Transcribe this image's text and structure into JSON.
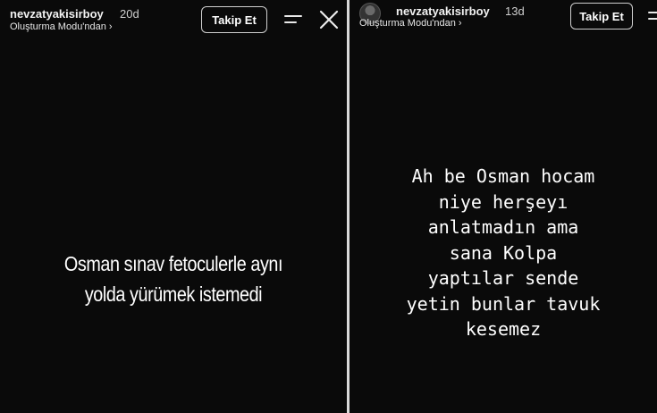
{
  "left_story": {
    "username": "nevzatyakisirboy",
    "time": "20d",
    "subtitle": "Oluşturma Modu'ndan ›",
    "follow_label": "Takip Et",
    "text_lines": [
      "Osman sınav fetoculerle aynı",
      "yolda yürümek istemedi"
    ]
  },
  "right_story": {
    "username": "nevzatyakisirboy",
    "time": "13d",
    "subtitle": "Oluşturma Modu'ndan ›",
    "follow_label": "Takip Et",
    "text_lines": [
      "Ah be Osman hocam",
      "niye herşeyı",
      "anlatmadın ama",
      "sana Kolpa",
      "yaptılar sende",
      "yetin bunlar tavuk",
      "kesemez"
    ]
  },
  "icons": {
    "menu": "menu-icon",
    "close": "close-icon",
    "avatar": "avatar"
  },
  "colors": {
    "background": "#0a0a0a",
    "text": "#ffffff",
    "divider": "#d9d9d9"
  }
}
